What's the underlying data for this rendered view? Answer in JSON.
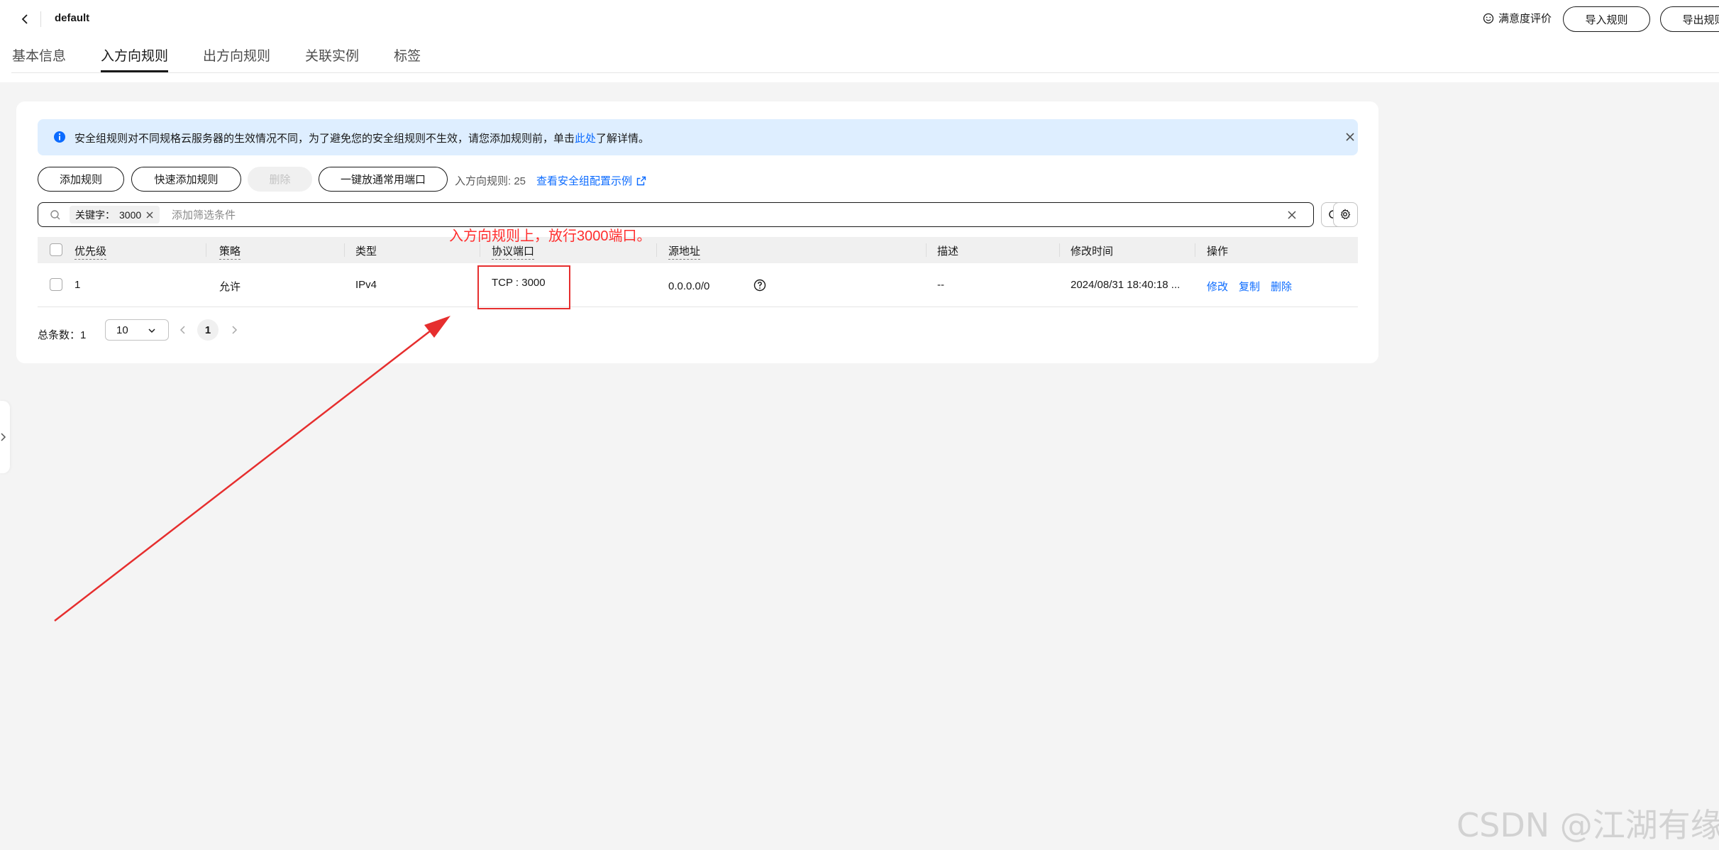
{
  "header": {
    "title": "default",
    "rate_label": "满意度评价",
    "import_label": "导入规则",
    "export_label": "导出规则",
    "tabs": [
      {
        "label": "基本信息",
        "active": false
      },
      {
        "label": "入方向规则",
        "active": true
      },
      {
        "label": "出方向规则",
        "active": false
      },
      {
        "label": "关联实例",
        "active": false
      },
      {
        "label": "标签",
        "active": false
      }
    ]
  },
  "alert": {
    "text_before": "安全组规则对不同规格云服务器的生效情况不同，为了避免您的安全组规则不生效，请您添加规则前，单击",
    "link": "此处",
    "text_after": "了解详情。"
  },
  "toolbar": {
    "add_label": "添加规则",
    "quick_add_label": "快速添加规则",
    "delete_label": "删除",
    "open_ports_label": "一键放通常用端口",
    "rule_count": "入方向规则: 25",
    "example_link": "查看安全组配置示例"
  },
  "search": {
    "tag_key": "关键字：",
    "tag_value": "3000",
    "placeholder": "添加筛选条件"
  },
  "table": {
    "columns": [
      "优先级",
      "策略",
      "类型",
      "协议端口",
      "源地址",
      "描述",
      "修改时间",
      "操作"
    ],
    "rows": [
      {
        "priority": "1",
        "policy": "允许",
        "type": "IPv4",
        "protocol_port": "TCP : 3000",
        "source": "0.0.0.0/0",
        "description": "--",
        "modified": "2024/08/31 18:40:18 ...",
        "actions": [
          "修改",
          "复制",
          "删除"
        ]
      }
    ]
  },
  "pager": {
    "total": "总条数：1",
    "page_size": "10",
    "current_page": "1"
  },
  "annotation": {
    "text": "入方向规则上，放行3000端口。",
    "color": "#ff2d2d"
  },
  "watermark": "CSDN @江湖有缘",
  "colors": {
    "link": "#0b6bff",
    "alert_bg": "#deeeff",
    "annotation": "#e62e2e"
  }
}
